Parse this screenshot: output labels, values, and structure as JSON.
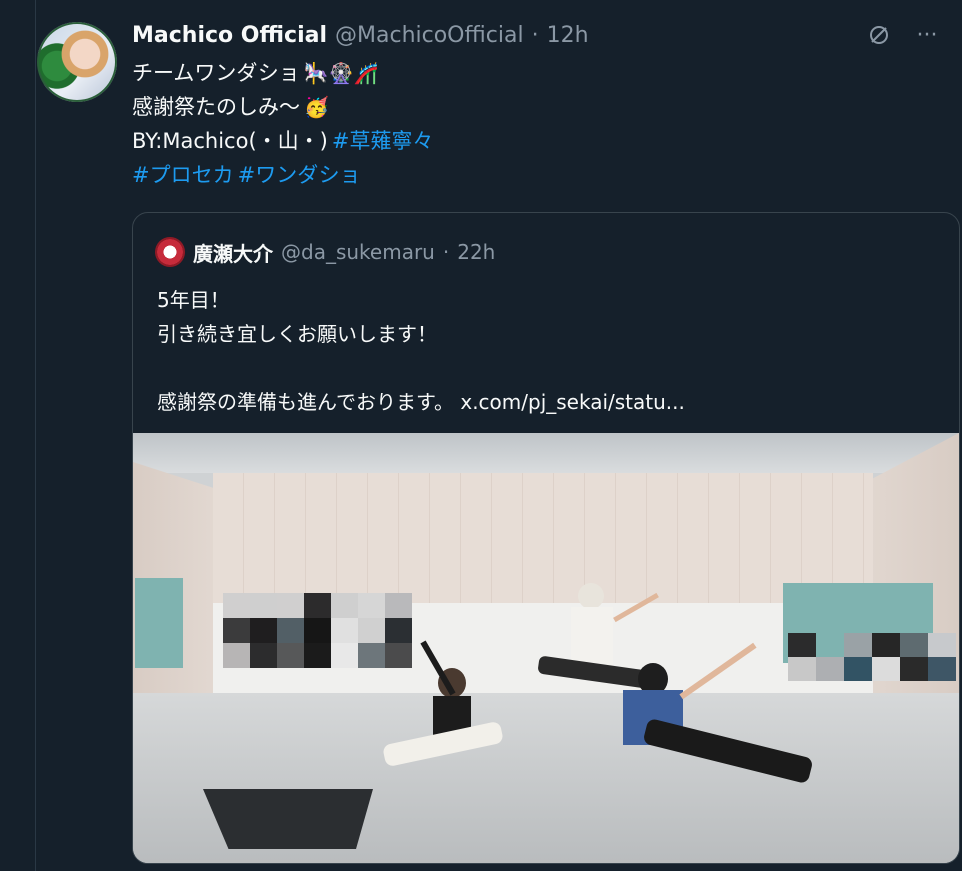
{
  "tweet": {
    "display_name": "Machico Official",
    "handle": "@MachicoOfficial",
    "separator": "·",
    "time": "12h",
    "lines": {
      "line1_text": "チームワンダショ",
      "line1_emoji": "🎠🎡🎢",
      "line2_text": "感謝祭たのしみ〜",
      "line2_emoji": "🥳",
      "line3_text": "BY:Machico(・山・)",
      "line3_hashtag": "#草薙寧々",
      "line4_hashtag1": "#プロセカ",
      "line4_hashtag2": "#ワンダショ"
    }
  },
  "actions": {
    "grok_icon": "slash-circle-icon",
    "more_icon": "more-icon",
    "grok_glyph": "⌀",
    "more_glyph": "···"
  },
  "quote": {
    "display_name": "廣瀬大介",
    "handle": "@da_sukemaru",
    "separator": "·",
    "time": "22h",
    "body": {
      "line1": "5年目！",
      "line2": "引き続き宜しくお願いします！",
      "line3": "感謝祭の準備も進んでおります。 x.com/pj_sekai/statu..."
    }
  },
  "colors": {
    "background": "#15202b",
    "text": "#f7f9f9",
    "muted": "#8b98a5",
    "link": "#1d9bf0",
    "border": "#38444d"
  }
}
